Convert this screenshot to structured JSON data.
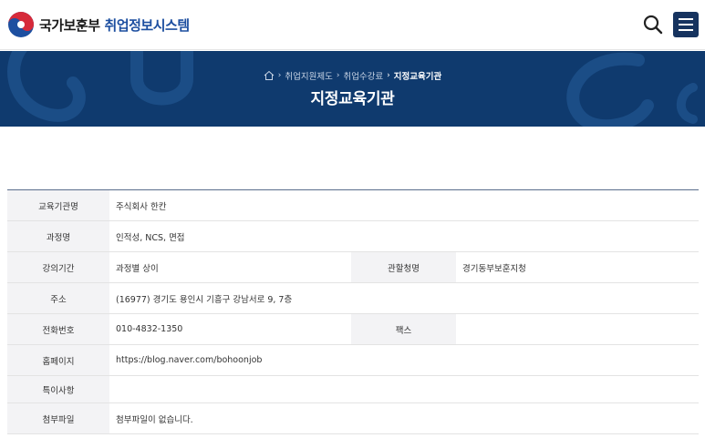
{
  "header": {
    "ministry": "국가보훈부",
    "system": "취업정보시스템"
  },
  "breadcrumb": {
    "items": [
      "취업지원제도",
      "취업수강료"
    ],
    "current": "지정교육기관"
  },
  "page_title": "지정교육기관",
  "table": {
    "rows": [
      {
        "label": "교육기관명",
        "value": "주식회사 한칸"
      },
      {
        "label": "과정명",
        "value": "인적성, NCS, 면접"
      },
      {
        "label": "강의기간",
        "value": "과정별 상이",
        "label2": "관할청명",
        "value2": "경기동부보훈지청"
      },
      {
        "label": "주소",
        "value": "(16977) 경기도 용인시 기흥구 강남서로 9, 7층"
      },
      {
        "label": "전화번호",
        "value": "010-4832-1350",
        "label2": "팩스",
        "value2": ""
      },
      {
        "label": "홈페이지",
        "value": "https://blog.naver.com/bohoonjob"
      },
      {
        "label": "특이사항",
        "value": ""
      },
      {
        "label": "첨부파일",
        "value": "첨부파일이 없습니다."
      }
    ]
  },
  "colors": {
    "brand_blue": "#1d4fa0",
    "banner_navy": "#0f3a6e",
    "menu_navy": "#16335f"
  },
  "icons": {
    "logo": "taegeuk-emblem",
    "search": "search-icon",
    "menu": "hamburger-icon",
    "home": "home-icon"
  }
}
